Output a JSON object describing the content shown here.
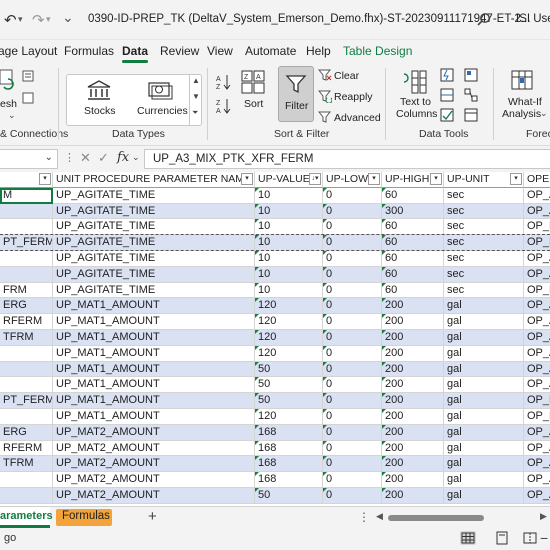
{
  "titlebar": {
    "title": "0390-ID-PREP_TK (DeltaV_System_Emerson_Demo.fhx)-ST-20230911171947-ET-2...",
    "user": "ISI User",
    "icons": [
      "undo-icon",
      "redo-icon",
      "search-icon"
    ]
  },
  "tabs": [
    "age Layout",
    "Formulas",
    "Data",
    "Review",
    "View",
    "Automate",
    "Help",
    "Table Design"
  ],
  "ribbon": {
    "get_data_label": "esh",
    "group_queries": "& Connections",
    "stocks": "Stocks",
    "currencies": "Currencies",
    "group_datatypes": "Data Types",
    "sort_az": "A↓Z",
    "sort": "Sort",
    "filter": "Filter",
    "clear": "Clear",
    "reapply": "Reapply",
    "advanced": "Advanced",
    "group_sortfilter": "Sort & Filter",
    "text_to": "Text to",
    "columns": "Columns",
    "group_datatools": "Data Tools",
    "whatif": "What-If",
    "analysis": "Analysis",
    "group_forecast": "Foreca"
  },
  "formula_bar": {
    "namebox": "",
    "formula": "UP_A3_MIX_PTK_XFR_FERM",
    "fx": "fx"
  },
  "table": {
    "headers": [
      "",
      "UNIT PROCEDURE PARAMETER NAME",
      "UP-VALUE",
      "UP-LOW",
      "UP-HIGH",
      "UP-UNIT",
      "OPER"
    ],
    "rows": [
      [
        "M",
        "UP_AGITATE_TIME",
        "10",
        "0",
        "60",
        "sec",
        "OP_A"
      ],
      [
        "",
        "UP_AGITATE_TIME",
        "10",
        "0",
        "300",
        "sec",
        "OP_A"
      ],
      [
        "",
        "UP_AGITATE_TIME",
        "10",
        "0",
        "60",
        "sec",
        "OP_P"
      ],
      [
        "PT_FERM",
        "UP_AGITATE_TIME",
        "10",
        "0",
        "60",
        "sec",
        "OP_P"
      ],
      [
        "",
        "UP_AGITATE_TIME",
        "10",
        "0",
        "60",
        "sec",
        "OP_A"
      ],
      [
        "",
        "UP_AGITATE_TIME",
        "10",
        "0",
        "60",
        "sec",
        "OP_A"
      ],
      [
        "FRM",
        "UP_AGITATE_TIME",
        "10",
        "0",
        "60",
        "sec",
        "OP_P"
      ],
      [
        "ERG",
        "UP_MAT1_AMOUNT",
        "120",
        "0",
        "200",
        "gal",
        "OP_A"
      ],
      [
        "RFERM",
        "UP_MAT1_AMOUNT",
        "120",
        "0",
        "200",
        "gal",
        "OP_A"
      ],
      [
        "TFRM",
        "UP_MAT1_AMOUNT",
        "120",
        "0",
        "200",
        "gal",
        "OP_A"
      ],
      [
        "",
        "UP_MAT1_AMOUNT",
        "120",
        "0",
        "200",
        "gal",
        "OP_A"
      ],
      [
        "",
        "UP_MAT1_AMOUNT",
        "50",
        "0",
        "200",
        "gal",
        "OP_A"
      ],
      [
        "",
        "UP_MAT1_AMOUNT",
        "50",
        "0",
        "200",
        "gal",
        "OP_A"
      ],
      [
        "PT_FERM",
        "UP_MAT1_AMOUNT",
        "50",
        "0",
        "200",
        "gal",
        "OP_P"
      ],
      [
        "",
        "UP_MAT1_AMOUNT",
        "120",
        "0",
        "200",
        "gal",
        "OP_P"
      ],
      [
        "ERG",
        "UP_MAT2_AMOUNT",
        "168",
        "0",
        "200",
        "gal",
        "OP_A"
      ],
      [
        "RFERM",
        "UP_MAT2_AMOUNT",
        "168",
        "0",
        "200",
        "gal",
        "OP_A"
      ],
      [
        "TFRM",
        "UP_MAT2_AMOUNT",
        "168",
        "0",
        "200",
        "gal",
        "OP_A"
      ],
      [
        "",
        "UP_MAT2_AMOUNT",
        "168",
        "0",
        "200",
        "gal",
        "OP_A"
      ],
      [
        "",
        "UP_MAT2_AMOUNT",
        "50",
        "0",
        "200",
        "gal",
        "OP_A"
      ]
    ]
  },
  "sheets": {
    "active": "arameters",
    "other": "Formulas",
    "add": "+",
    "more": "⋮"
  },
  "status": {
    "text": "go"
  },
  "colors": {
    "accent": "#107c41",
    "band": "#d9e1f2",
    "formulas_tab": "#f2a33a"
  }
}
